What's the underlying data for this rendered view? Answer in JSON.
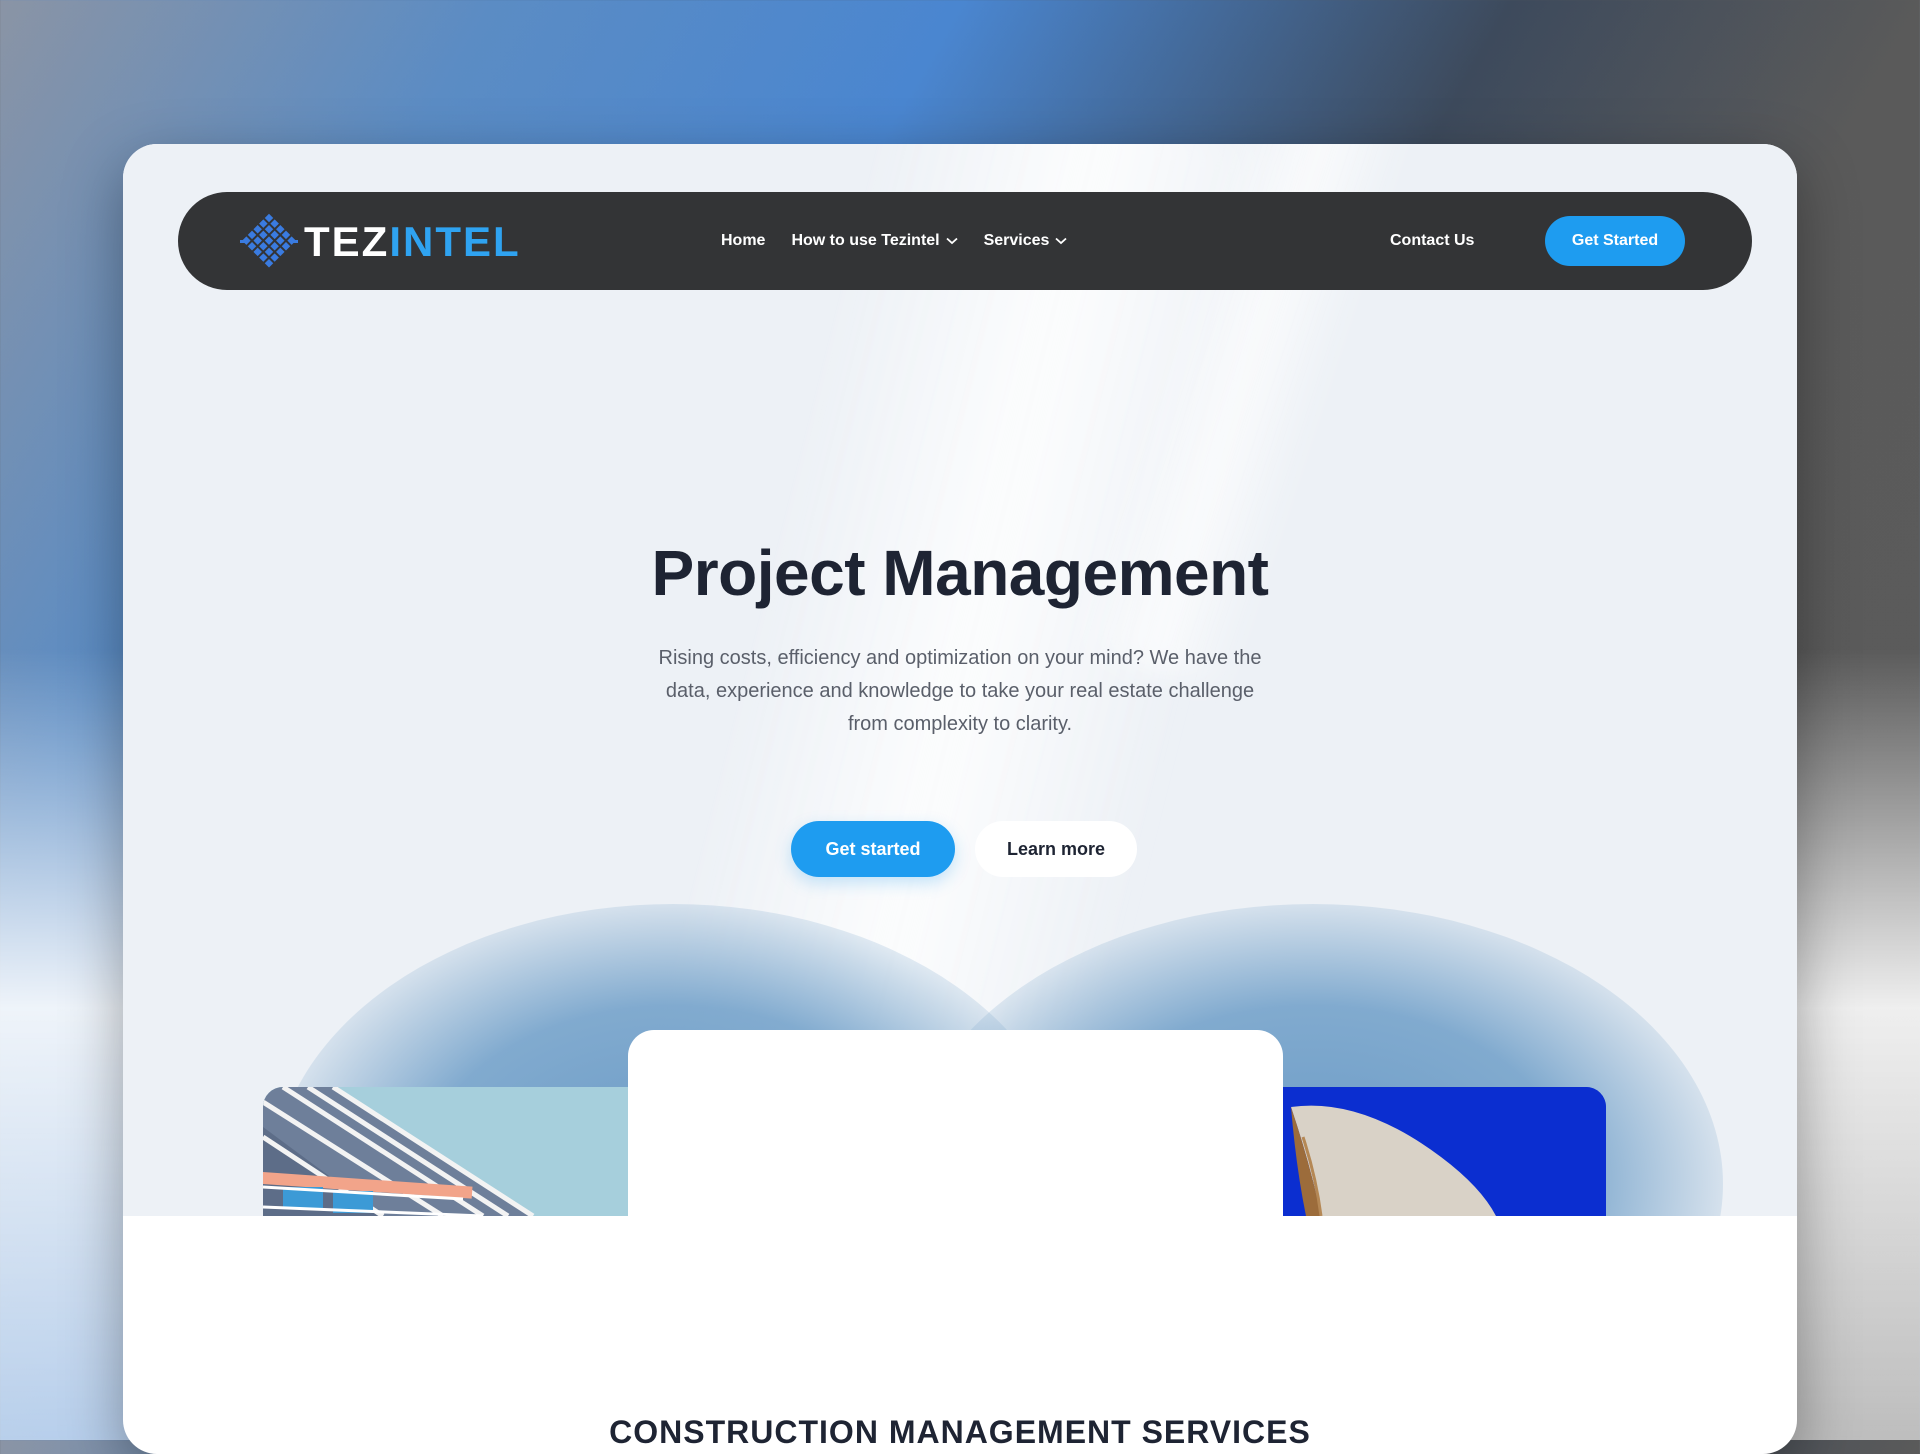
{
  "nav": {
    "logo": {
      "part1": "TEZ",
      "part2": "INTEL"
    },
    "links": [
      {
        "label": "Home",
        "has_dropdown": false
      },
      {
        "label": "How to use Tezintel",
        "has_dropdown": true
      },
      {
        "label": "Services",
        "has_dropdown": true
      }
    ],
    "contact_label": "Contact Us",
    "cta_label": "Get Started"
  },
  "hero": {
    "title": "Project Management",
    "subtitle": "Rising costs, efficiency and optimization on your mind? We have the data, experience and knowledge to take your real estate challenge from complexity to clarity.",
    "primary_button": "Get started",
    "secondary_button": "Learn more"
  },
  "section": {
    "heading": "CONSTRUCTION MANAGEMENT SERVICES"
  },
  "colors": {
    "accent": "#1e9cf0",
    "nav_bg": "#333436",
    "heading": "#1e2433",
    "logo_accent": "#2fa3f1"
  }
}
